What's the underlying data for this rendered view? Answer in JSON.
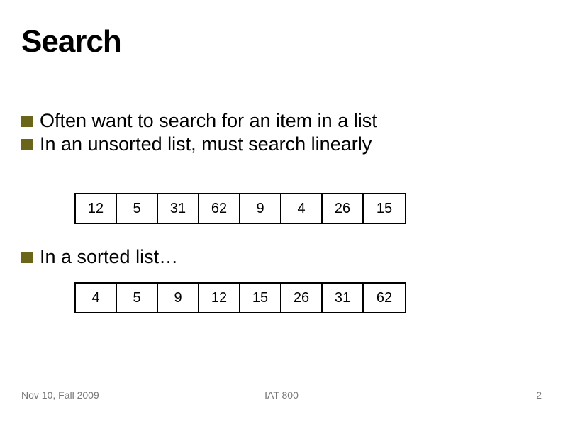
{
  "title": "Search",
  "bullets": {
    "line1": "Often want to search for an item in a list",
    "line2": "In an unsorted list, must search linearly",
    "line3": "In a sorted list…"
  },
  "unsorted_list": {
    "c0": "12",
    "c1": "5",
    "c2": "31",
    "c3": "62",
    "c4": "9",
    "c5": "4",
    "c6": "26",
    "c7": "15"
  },
  "sorted_list": {
    "c0": "4",
    "c1": "5",
    "c2": "9",
    "c3": "12",
    "c4": "15",
    "c5": "26",
    "c6": "31",
    "c7": "62"
  },
  "footer": {
    "left": "Nov 10, Fall 2009",
    "center": "IAT 800",
    "right": "2"
  }
}
